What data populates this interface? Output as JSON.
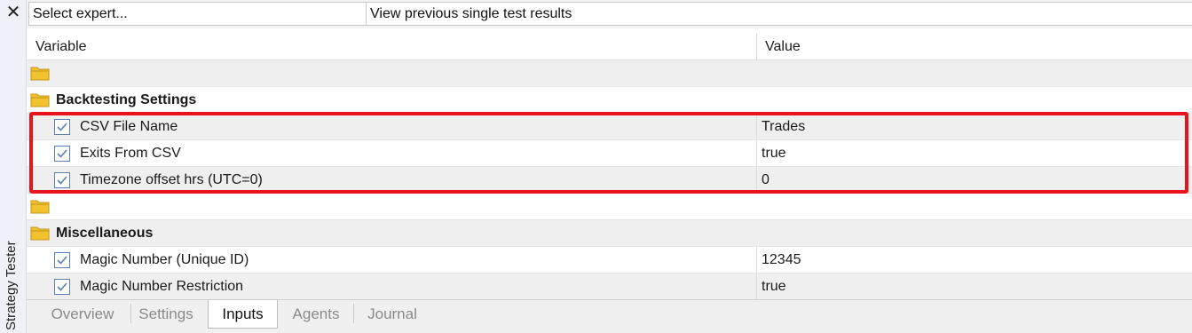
{
  "sidebar": {
    "close_glyph": "✕",
    "title": "Strategy Tester"
  },
  "toolbar": {
    "select_expert": "Select expert...",
    "view_previous": "View previous single test results"
  },
  "grid": {
    "headers": {
      "variable": "Variable",
      "value": "Value"
    },
    "rows": [
      {
        "kind": "folder",
        "label": "",
        "value": ""
      },
      {
        "kind": "group",
        "label": "Backtesting Settings",
        "value": ""
      },
      {
        "kind": "item",
        "label": "CSV File Name",
        "value": "Trades",
        "checked": true
      },
      {
        "kind": "item",
        "label": "Exits From CSV",
        "value": "true",
        "checked": true
      },
      {
        "kind": "item",
        "label": "Timezone offset hrs (UTC=0)",
        "value": "0",
        "checked": true
      },
      {
        "kind": "folder",
        "label": "",
        "value": ""
      },
      {
        "kind": "group",
        "label": "Miscellaneous",
        "value": ""
      },
      {
        "kind": "item",
        "label": "Magic Number (Unique ID)",
        "value": "12345",
        "checked": true
      },
      {
        "kind": "item",
        "label": "Magic Number Restriction",
        "value": "true",
        "checked": true
      }
    ]
  },
  "tabs": [
    {
      "label": "Overview",
      "active": false
    },
    {
      "label": "Settings",
      "active": false
    },
    {
      "label": "Inputs",
      "active": true
    },
    {
      "label": "Agents",
      "active": false
    },
    {
      "label": "Journal",
      "active": false
    }
  ],
  "colors": {
    "highlight": "#e8141c",
    "folder": "#f2c12e",
    "checkbox": "#5a7fb0"
  },
  "icons": {
    "folder": "folder-icon",
    "checkbox": "checkbox-checked-icon",
    "close": "close-icon",
    "chevron": "chevron-down-icon"
  }
}
